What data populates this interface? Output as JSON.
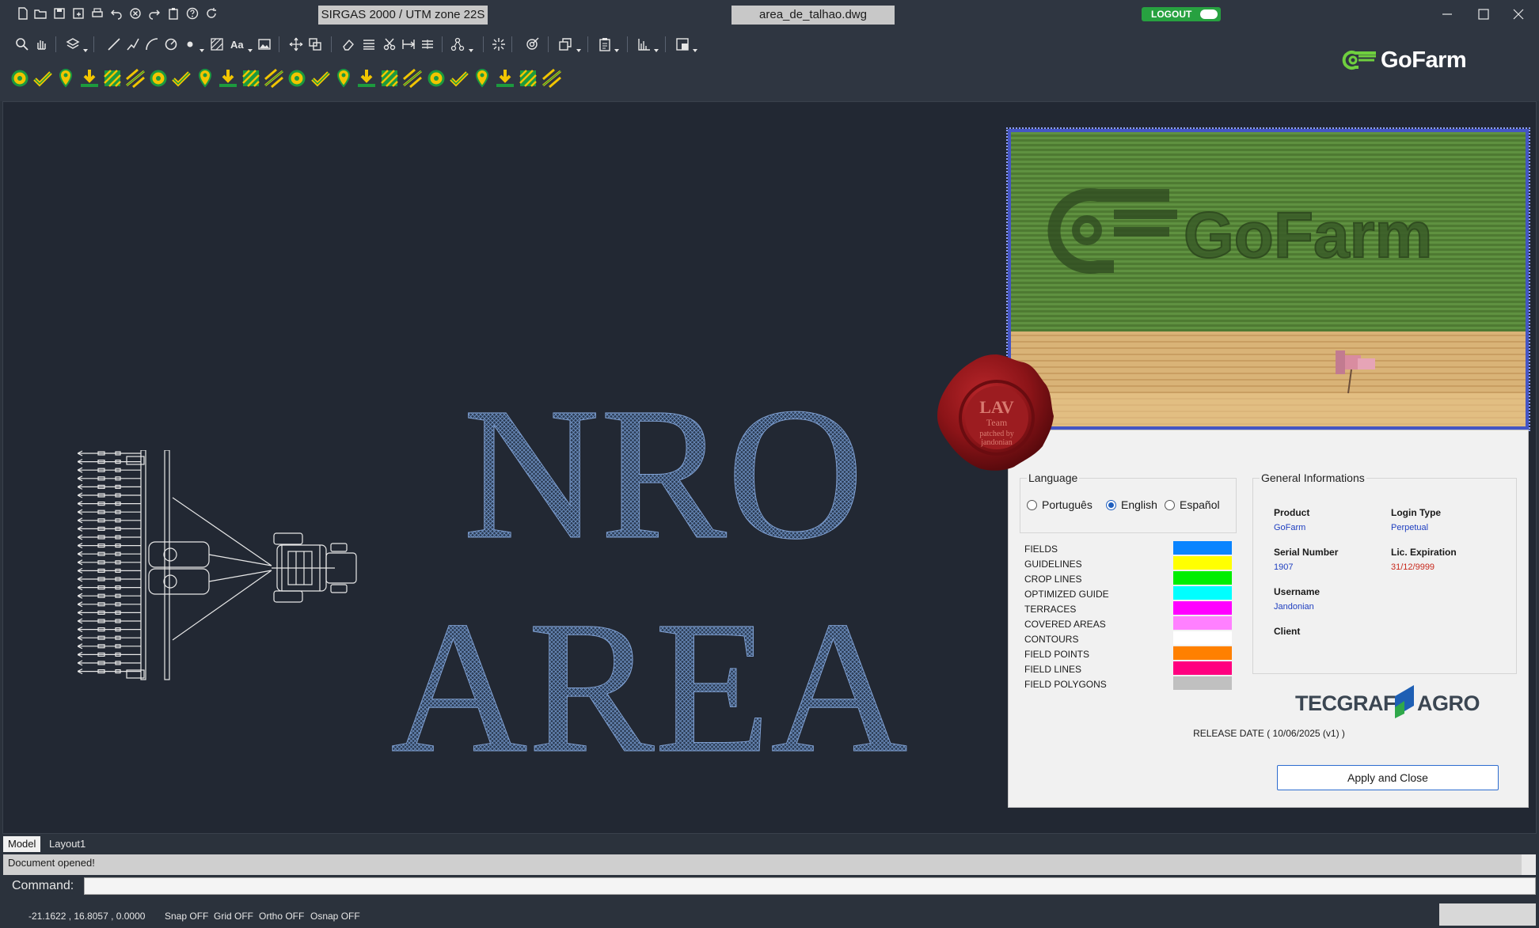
{
  "titlebar": {
    "crs": "SIRGAS 2000 / UTM zone 22S",
    "file": "area_de_talhao.dwg",
    "logout": "LOGOUT",
    "quick_icons": [
      "new-file-icon",
      "open-file-icon",
      "save-icon",
      "save-as-icon",
      "print-icon",
      "undo-icon",
      "cancel-icon",
      "redo-icon",
      "clipboard-icon",
      "help-icon",
      "refresh-icon"
    ]
  },
  "brand": {
    "name": "GoFarm"
  },
  "canvas": {
    "text_line1": "NRO",
    "text_line2": "AREA"
  },
  "splash": {
    "banner_text": "GoFarm",
    "seal": {
      "line1": "LAV",
      "line2": "Team",
      "line3": "patched by",
      "line4": "jandonian"
    },
    "language": {
      "title": "Language",
      "options": [
        {
          "label": "Português",
          "checked": false
        },
        {
          "label": "English",
          "checked": true
        },
        {
          "label": "Español",
          "checked": false
        }
      ]
    },
    "layers": [
      {
        "name": "FIELDS",
        "color": "#0a84ff"
      },
      {
        "name": "GUIDELINES",
        "color": "#ffff00"
      },
      {
        "name": "CROP LINES",
        "color": "#00ee00"
      },
      {
        "name": "OPTIMIZED GUIDE",
        "color": "#00ffff"
      },
      {
        "name": "TERRACES",
        "color": "#ff00ff"
      },
      {
        "name": "COVERED AREAS",
        "color": "#ff80ff"
      },
      {
        "name": "CONTOURS",
        "color": "#ffffff"
      },
      {
        "name": "FIELD POINTS",
        "color": "#ff8000"
      },
      {
        "name": "FIELD LINES",
        "color": "#ff0080"
      },
      {
        "name": "FIELD POLYGONS",
        "color": "#c0c0c0"
      }
    ],
    "info": {
      "title": "General Informations",
      "product_label": "Product",
      "product_value": "GoFarm",
      "login_type_label": "Login Type",
      "login_type_value": "Perpetual",
      "serial_label": "Serial Number",
      "serial_value": "1907",
      "expiration_label": "Lic. Expiration",
      "expiration_value": "31/12/9999",
      "username_label": "Username",
      "username_value": "Jandonian",
      "client_label": "Client"
    },
    "vendor": {
      "left": "TECGRAF",
      "right": "AGRO"
    },
    "release": "RELEASE DATE ( 10/06/2025 (v1) )",
    "apply_button": "Apply and Close"
  },
  "tabs": [
    "Model",
    "Layout1"
  ],
  "history": "Document opened!",
  "command": {
    "label": "Command:",
    "value": ""
  },
  "status": {
    "coords": "-21.1622 , 16.8057 , 0.0000",
    "snap": "Snap OFF",
    "grid": "Grid OFF",
    "ortho": "Ortho OFF",
    "osnap": "Osnap OFF"
  },
  "colors": {
    "accent_green": "#27a140",
    "toolbar_yellow": "#f2c500",
    "toolbar_green": "#1c9a3e",
    "hatch_blue": "#4a6fa0",
    "link_blue": "#1f3fc0",
    "expiry_red": "#c8281c"
  }
}
